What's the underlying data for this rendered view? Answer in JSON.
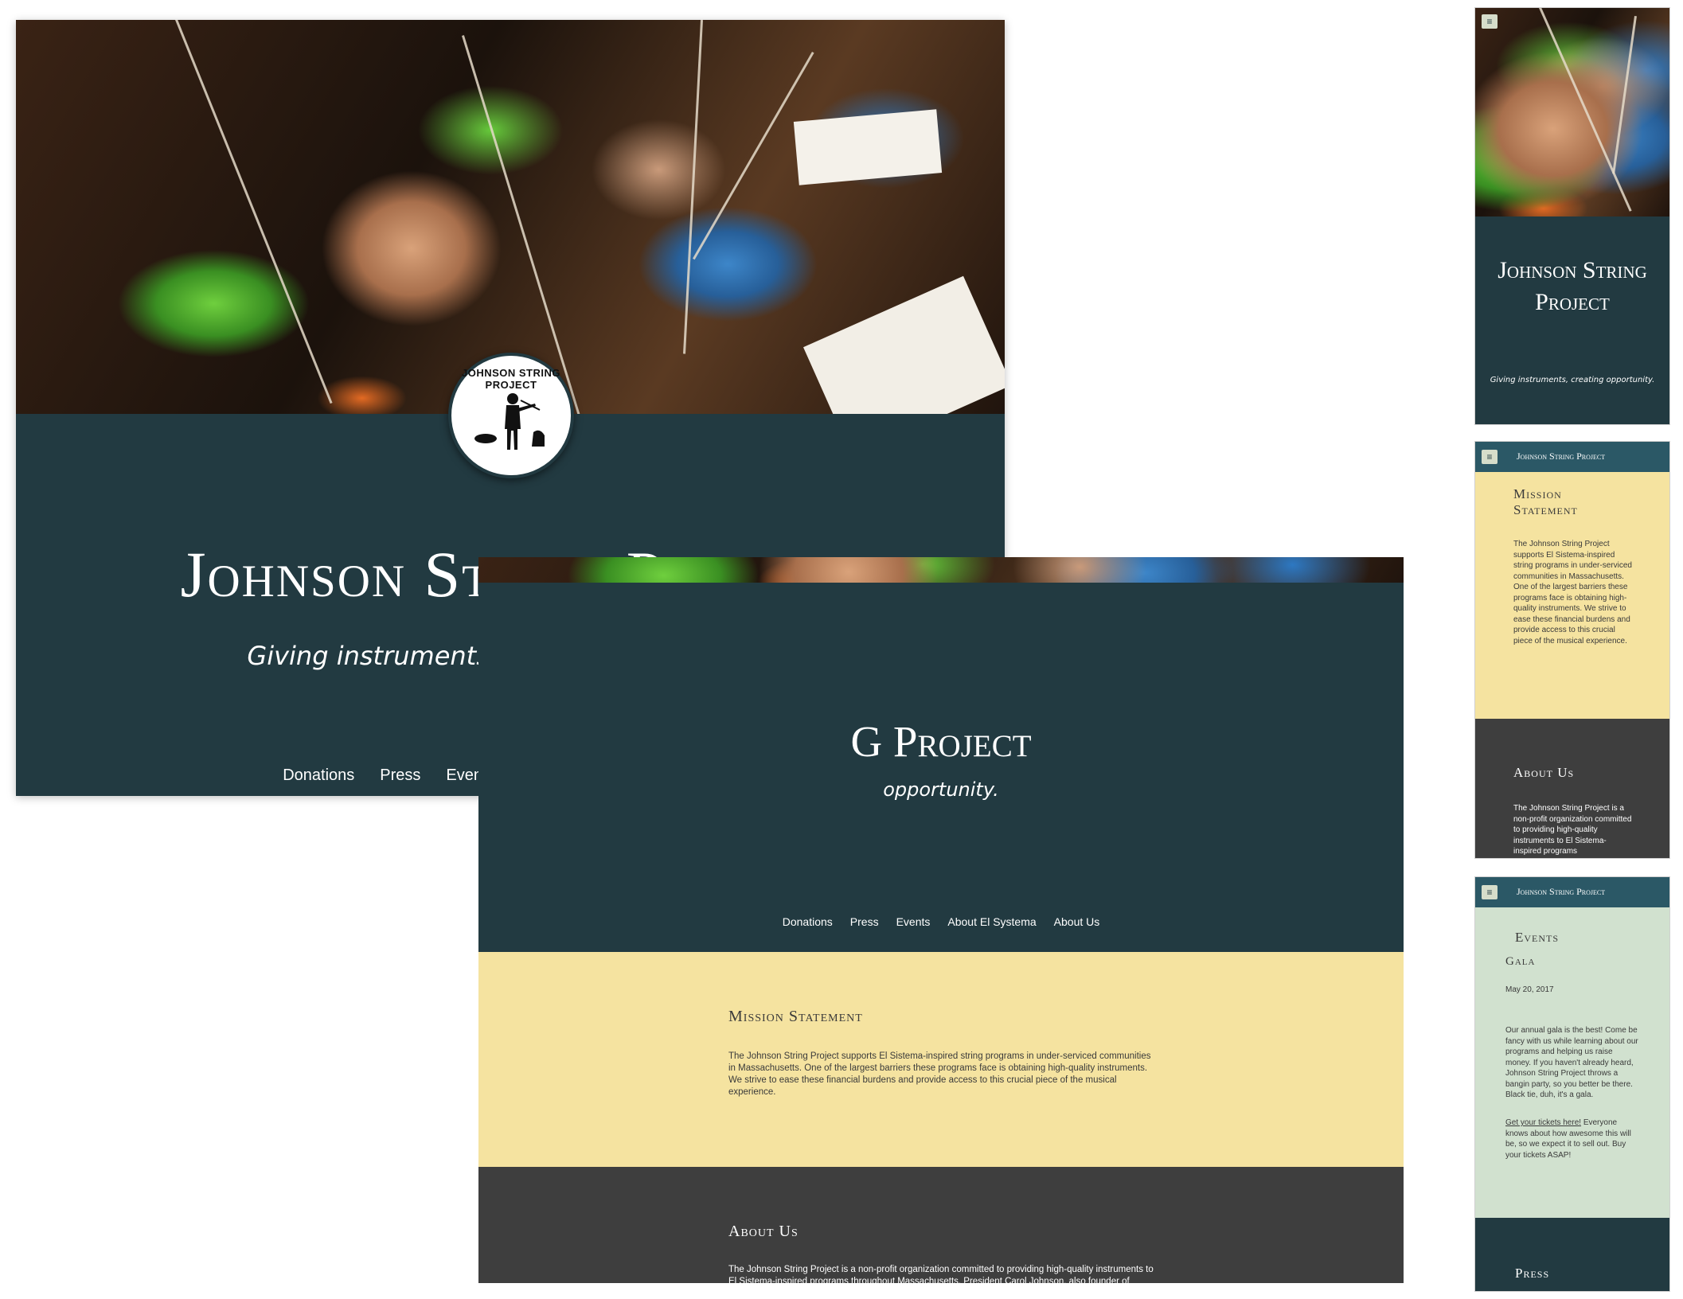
{
  "site": {
    "title": "Johnson String Project",
    "tagline": "Giving instruments, creating opportunity.",
    "logo_text_line1": "JOHNSON STRING",
    "logo_text_line2": "PROJECT",
    "colors": {
      "teal": "#223a41",
      "mission_bg": "#f5e3a0",
      "about_bg": "#3e3e3e",
      "events_bg": "#d1e1cf",
      "mobile_bar": "#2b5866"
    }
  },
  "nav": {
    "items": [
      {
        "label": "Donations"
      },
      {
        "label": "Press"
      },
      {
        "label": "Events"
      },
      {
        "label": "About El Systema"
      },
      {
        "label": "About Us"
      }
    ]
  },
  "medium": {
    "title_visible": "G Project",
    "tagline_visible": "opportunity."
  },
  "mission": {
    "heading": "Mission Statement",
    "body": "The Johnson String Project supports El Sistema-inspired string programs in under-serviced communities in Massachusetts. One of the largest barriers these programs face is obtaining high-quality instruments. We strive to ease these financial burdens and provide access to this crucial piece of the musical experience."
  },
  "about": {
    "heading": "About Us",
    "body_desktop": "The Johnson String Project is a non-profit organization committed to providing high-quality instruments to El Sistema-inspired programs throughout Massachusetts. President Carol Johnson, also founder of",
    "body_mobile": "The Johnson String Project is a non-profit organization committed to providing high-quality instruments to El Sistema-inspired programs"
  },
  "events": {
    "heading": "Events",
    "event_name": "Gala",
    "date": "May 20, 2017",
    "description": "Our annual gala is the best! Come be fancy with us while learning about our programs and helping us raise money. If you haven't already heard, Johnson String Project throws a bangin party, so you better be there. Black tie, duh, it's a gala.",
    "ticket_link": "Get your tickets here!",
    "ticket_text": " Everyone knows about how awesome this will be, so we expect it to sell out. Buy your tickets ASAP!"
  },
  "press": {
    "heading": "Press"
  },
  "icons": {
    "menu": "hamburger-menu-icon",
    "logo": "violinist-silhouette-logo"
  }
}
